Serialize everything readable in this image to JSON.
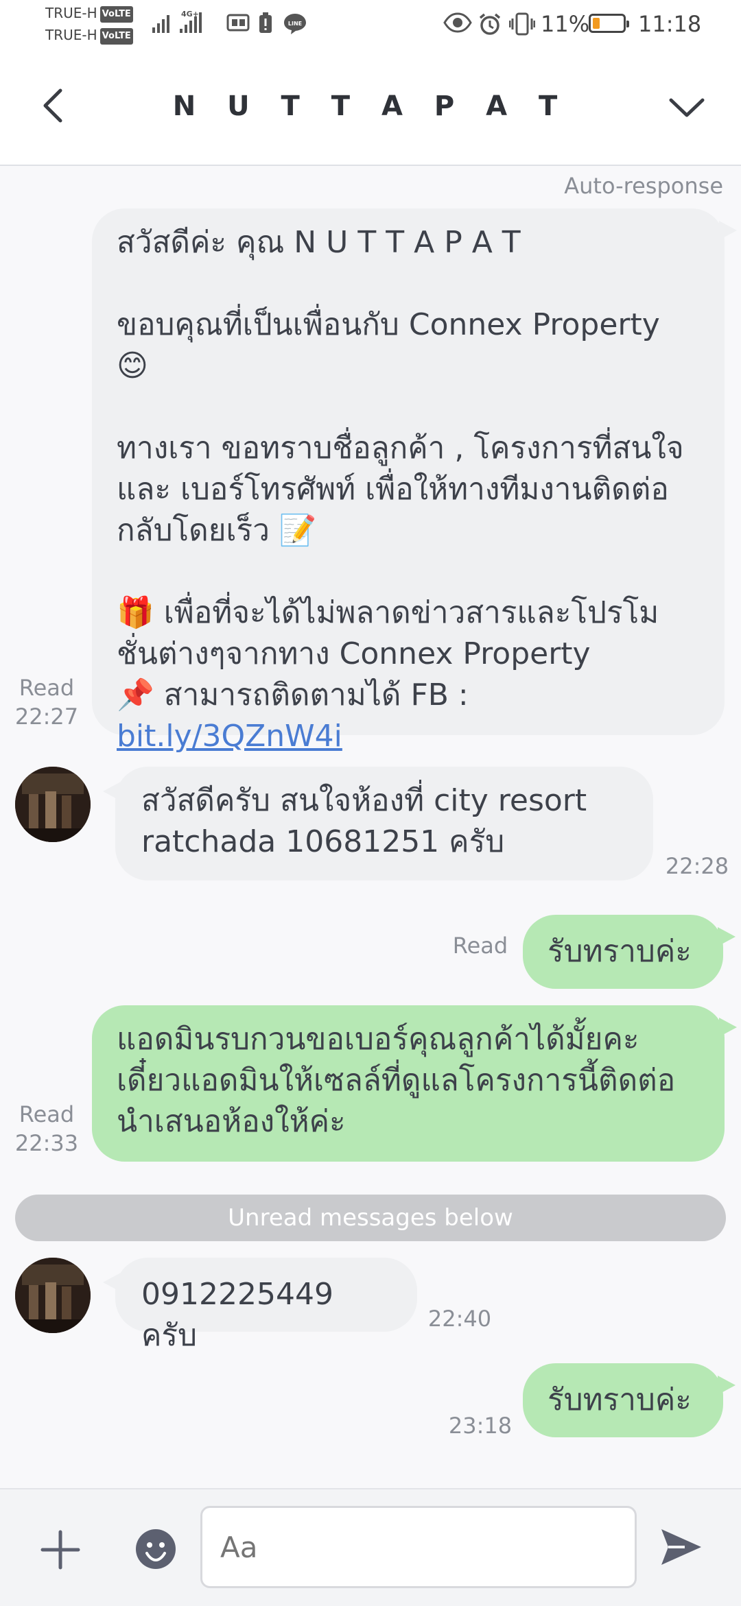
{
  "status_bar": {
    "carrier1": "TRUE-H",
    "carrier2": "TRUE-H",
    "volte": "VoLTE",
    "battery_text": "11%",
    "battery_level": 0.11,
    "battery_color": "#f29a1f",
    "time": "11:18",
    "icons": [
      "signal-icon",
      "4g-signal-icon",
      "storage-icon",
      "battery-alert-icon",
      "line-app-icon",
      "eye-icon",
      "alarm-icon",
      "vibrate-icon"
    ]
  },
  "header": {
    "title": "N U T T A P A T",
    "back_icon": "chevron-left-icon",
    "menu_icon": "chevron-down-icon"
  },
  "chat": {
    "auto_label": "Auto-response",
    "messages": [
      {
        "side": "out",
        "text_part1": "สวัสดีค่ะ คุณ N U T T A P A T\n\nขอบคุณที่เป็นเพื่อนกับ Connex Property\n😊\n\nทางเรา ขอทราบชื่อลูกค้า , โครงการที่สนใจ และ เบอร์โทรศัพท์ เพื่อให้ทางทีมงานติดต่อกลับโดยเร็ว 📝\n\n🎁 เพื่อที่จะได้ไม่พลาดข่าวสารและโปรโมชั่นต่างๆจากทาง Connex Property\n📌 สามารถติดตามได้ FB : ",
        "link": "bit.ly/3QZnW4i",
        "read": "Read",
        "time": "22:27"
      },
      {
        "side": "in",
        "text": "สวัสดีครับ สนใจห้องที่ city resort ratchada 10681251 ครับ",
        "time": "22:28"
      },
      {
        "side": "out",
        "text": "รับทราบค่ะ",
        "read": "Read"
      },
      {
        "side": "out",
        "text": "แอดมินรบกวนขอเบอร์คุณลูกค้าได้มั้ยคะ เดี๋ยวแอดมินให้เซลล์ที่ดูแลโครงการนี้ติดต่อนำเสนอห้องให้ค่ะ",
        "read": "Read",
        "time": "22:33"
      },
      {
        "side": "in",
        "text": "0912225449 ครับ",
        "time": "22:40"
      },
      {
        "side": "out",
        "text": "รับทราบค่ะ",
        "time": "23:18"
      }
    ],
    "unread_divider": "Unread messages below"
  },
  "composer": {
    "placeholder": "Aa"
  }
}
